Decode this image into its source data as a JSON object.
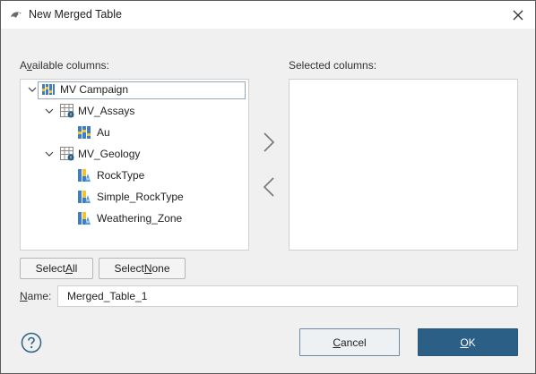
{
  "window": {
    "title": "New Merged Table",
    "app_icon": "leapfrog-app-icon",
    "close_icon": "close-icon"
  },
  "available": {
    "label_pre": "A",
    "label_mnemonic": "v",
    "label_post": "ailable columns:",
    "tree": [
      {
        "label": "MV Campaign",
        "icon": "campaign-icon",
        "level": 0,
        "expanded": true,
        "selected": true
      },
      {
        "label": "MV_Assays",
        "icon": "table-icon",
        "level": 1,
        "expanded": true
      },
      {
        "label": "Au",
        "icon": "numeric-column-icon",
        "level": 2
      },
      {
        "label": "MV_Geology",
        "icon": "table-icon",
        "level": 1,
        "expanded": true
      },
      {
        "label": "RockType",
        "icon": "category-column-icon",
        "level": 2
      },
      {
        "label": "Simple_RockType",
        "icon": "category-column-icon",
        "level": 2
      },
      {
        "label": "Weathering_Zone",
        "icon": "category-column-icon",
        "level": 2
      }
    ]
  },
  "selected": {
    "label": "Selected columns:",
    "items": []
  },
  "transfer": {
    "add_icon": "chevron-right-icon",
    "remove_icon": "chevron-left-icon"
  },
  "buttons": {
    "select_all_pre": "Select ",
    "select_all_mnemonic": "A",
    "select_all_post": "ll",
    "select_none_pre": "Select ",
    "select_none_mnemonic": "N",
    "select_none_post": "one",
    "cancel_mnemonic": "C",
    "cancel_post": "ancel",
    "ok_mnemonic": "O",
    "ok_post": "K"
  },
  "name_field": {
    "label_mnemonic": "N",
    "label_post": "ame:",
    "value": "Merged_Table_1"
  },
  "help_icon": "help-icon",
  "colors": {
    "ok_bg": "#2b5f86",
    "cancel_border": "#6f8aa5",
    "icon_blue": "#3c7fc7",
    "icon_yellow": "#f0c330"
  }
}
